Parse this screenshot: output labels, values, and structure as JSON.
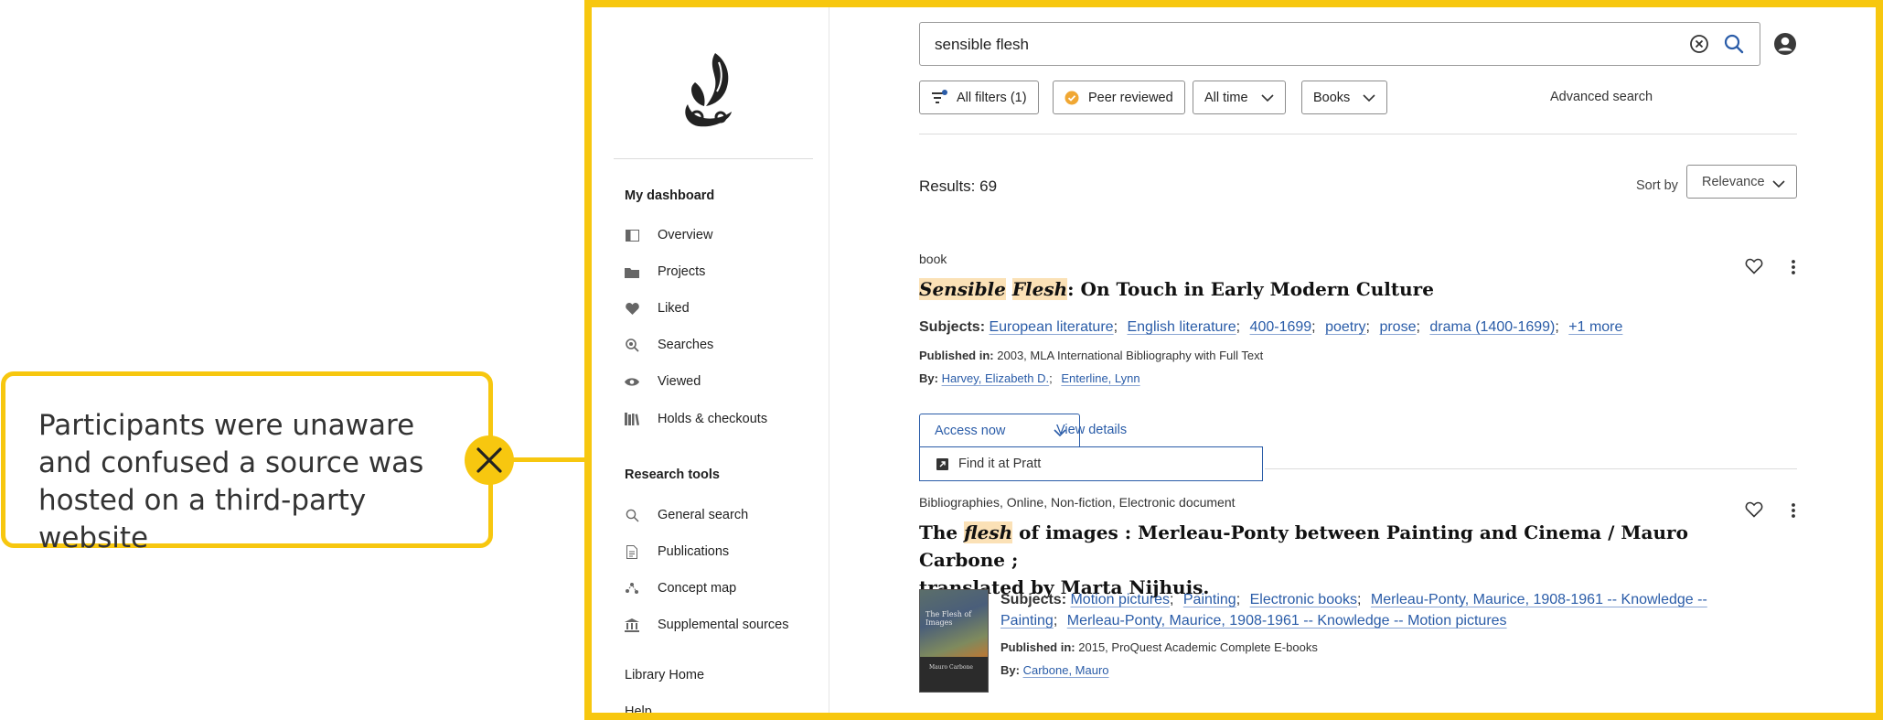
{
  "callout": {
    "text": "Participants were unaware and confused a source was hosted on a third-party website"
  },
  "colors": {
    "accent": "#f7c70f",
    "link": "#2a5ca8",
    "highlight": "#fbe1b6",
    "chat": "#2a66b8"
  },
  "sidebar": {
    "dashboard_heading": "My dashboard",
    "dashboard_items": [
      {
        "label": "Overview",
        "icon": "overview-icon"
      },
      {
        "label": "Projects",
        "icon": "folder-icon"
      },
      {
        "label": "Liked",
        "icon": "heart-icon"
      },
      {
        "label": "Searches",
        "icon": "saved-search-icon"
      },
      {
        "label": "Viewed",
        "icon": "eye-icon"
      },
      {
        "label": "Holds & checkouts",
        "icon": "books-icon"
      }
    ],
    "research_heading": "Research tools",
    "research_items": [
      {
        "label": "General search",
        "icon": "search-icon"
      },
      {
        "label": "Publications",
        "icon": "document-icon"
      },
      {
        "label": "Concept map",
        "icon": "concept-map-icon"
      },
      {
        "label": "Supplemental sources",
        "icon": "institution-icon"
      }
    ],
    "links": [
      "Library Home",
      "Help"
    ]
  },
  "search": {
    "value": "sensible flesh"
  },
  "filters": {
    "all_filters": "All filters (1)",
    "peer_reviewed": "Peer reviewed",
    "time": "All time",
    "format": "Books",
    "advanced": "Advanced search"
  },
  "results_header": {
    "count": "Results: 69",
    "sort_label": "Sort by",
    "sort_value": "Relevance"
  },
  "results": [
    {
      "type": "book",
      "title_parts": [
        "Sensible",
        " ",
        "Flesh",
        ": On Touch in Early Modern Culture"
      ],
      "subjects_label": "Subjects:",
      "subjects": [
        "European literature",
        "English literature",
        "400-1699",
        "poetry",
        "prose",
        "drama (1400-1699)",
        "+1 more"
      ],
      "published_label": "Published in:",
      "published": "2003, MLA International Bibliography with Full Text",
      "by_label": "By:",
      "authors": [
        "Harvey, Elizabeth D.",
        "Enterline, Lynn"
      ],
      "access_label": "Access now",
      "view_details": "View details",
      "access_option": "Find it at Pratt"
    },
    {
      "type": "Bibliographies, Online, Non-fiction, Electronic document",
      "title_parts": [
        "The ",
        "flesh",
        " of images : Merleau-Ponty between Painting and Cinema / Mauro Carbone ;",
        "translated by Marta Nijhuis."
      ],
      "subjects_label": "Subjects:",
      "subjects": [
        "Motion pictures",
        "Painting",
        "Electronic books",
        "Merleau-Ponty, Maurice, 1908-1961 -- Knowledge --",
        "Painting",
        "Merleau-Ponty, Maurice, 1908-1961 -- Knowledge -- Motion pictures"
      ],
      "published_label": "Published in:",
      "published": "2015, ProQuest Academic Complete E-books",
      "by_label": "By:",
      "authors": [
        "Carbone, Mauro"
      ],
      "thumb_text": "The Flesh of Images",
      "thumb_author": "Mauro Carbone"
    }
  ],
  "chat": {
    "badge": "×"
  }
}
